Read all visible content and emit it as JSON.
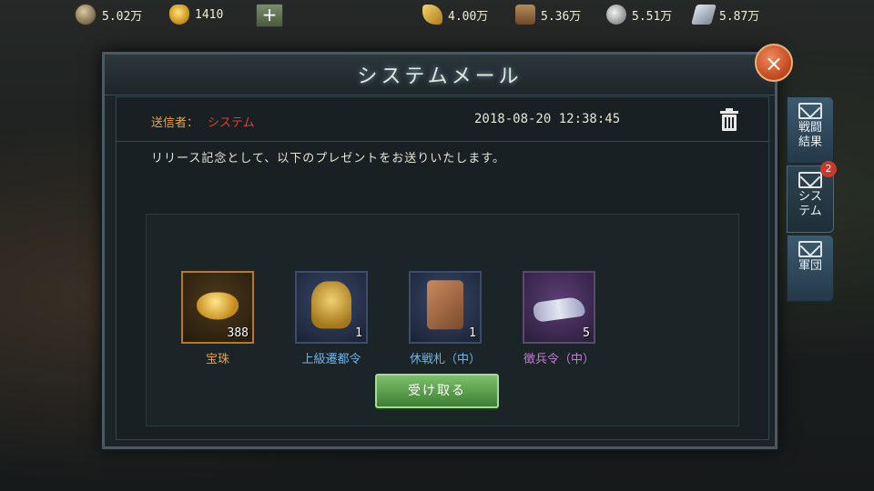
{
  "resources": {
    "coin": "5.02万",
    "ingot": "1410",
    "grain": "4.00万",
    "wood": "5.36万",
    "stone": "5.51万",
    "iron": "5.87万"
  },
  "dialog": {
    "title": "システムメール",
    "close_label": "×",
    "sender_label": "送信者：",
    "sender_name": "システム",
    "date": "2018-08-20 12:38:45",
    "message": "リリース記念として、以下のプレゼントをお送りいたします。",
    "receive_button": "受け取る"
  },
  "rewards": [
    {
      "name": "宝珠",
      "qty": "388",
      "name_color": "#e9a14a",
      "icon": "gold-ingot"
    },
    {
      "name": "上級遷都令",
      "qty": "1",
      "name_color": "#6fb3e8",
      "icon": "gold-token"
    },
    {
      "name": "休戦札（中）",
      "qty": "1",
      "name_color": "#6fb3e8",
      "icon": "truce-plate"
    },
    {
      "name": "徴兵令（中）",
      "qty": "5",
      "name_color": "#c97bdc",
      "icon": "silver-beast"
    }
  ],
  "tabs": [
    {
      "label": "戦闘結果"
    },
    {
      "label": "システム",
      "badge": "2"
    },
    {
      "label": "軍団"
    }
  ]
}
